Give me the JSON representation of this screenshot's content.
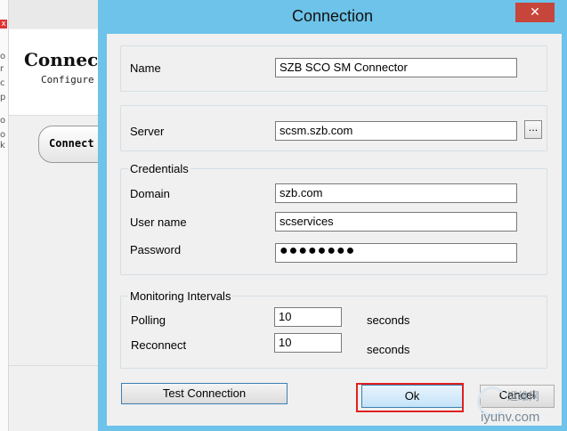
{
  "background_window": {
    "title": "Connect",
    "subtitle": "Configure",
    "pill_label": "Connect",
    "close_glyph": "x",
    "side_glyphs": [
      "o",
      "r",
      "c",
      "p",
      "o",
      "o",
      "k"
    ]
  },
  "dialog": {
    "title": "Connection",
    "close_glyph": "✕"
  },
  "fields": {
    "name": {
      "label": "Name",
      "value": "SZB SCO SM Connector"
    },
    "server": {
      "label": "Server",
      "value": "scsm.szb.com",
      "browse_label": "..."
    }
  },
  "credentials": {
    "legend": "Credentials",
    "domain": {
      "label": "Domain",
      "value": "szb.com"
    },
    "user_name": {
      "label": "User name",
      "value": "scservices"
    },
    "password": {
      "label": "Password",
      "value": "●●●●●●●●"
    }
  },
  "monitoring": {
    "legend": "Monitoring Intervals",
    "polling": {
      "label": "Polling",
      "value": "10",
      "unit": "seconds"
    },
    "reconnect": {
      "label": "Reconnect",
      "value": "10",
      "unit": "seconds"
    }
  },
  "buttons": {
    "test_connection": "Test Connection",
    "ok": "Ok",
    "cancel": "Cancel"
  },
  "watermark": {
    "cn": "运维网",
    "url": "iyunv.com"
  },
  "colors": {
    "title_bar": "#6dc3e9",
    "close_button": "#c7463c",
    "highlight": "#e02020"
  }
}
